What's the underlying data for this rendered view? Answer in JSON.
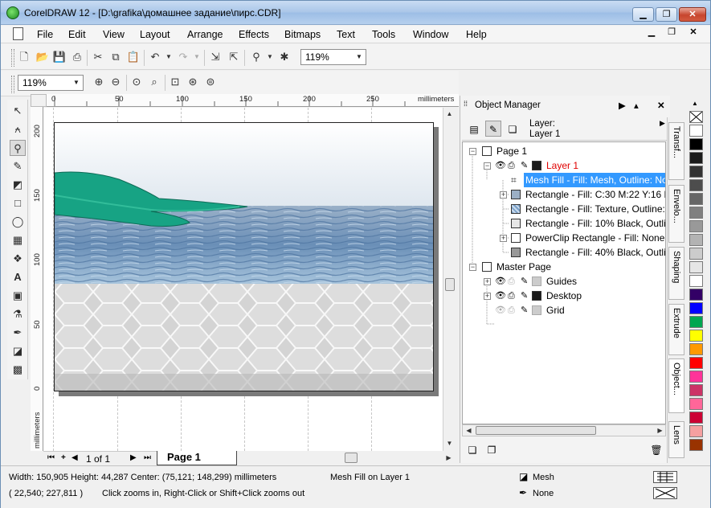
{
  "window": {
    "title": "CorelDRAW 12 - [D:\\grafika\\домашнее задание\\пирс.CDR]",
    "minimize": "▁",
    "maximize": "❐",
    "close": "✕"
  },
  "menu": [
    "File",
    "Edit",
    "View",
    "Layout",
    "Arrange",
    "Effects",
    "Bitmaps",
    "Text",
    "Tools",
    "Window",
    "Help"
  ],
  "toolbar": {
    "zoom_value": "119%"
  },
  "zoombar": {
    "zoom_value": "119%"
  },
  "rulers": {
    "units": "millimeters",
    "h_labels": [
      "0",
      "50",
      "100",
      "150",
      "200",
      "250"
    ],
    "v_labels": [
      "200",
      "150",
      "100",
      "50",
      "0"
    ]
  },
  "pages": {
    "counter": "1 of 1",
    "current_tab": "Page 1"
  },
  "object_manager": {
    "title": "Object Manager",
    "layer_label": "Layer:",
    "layer_name": "Layer 1",
    "tree": {
      "page1": "Page 1",
      "layer1": "Layer 1",
      "items": [
        "Mesh Fill - Fill: Mesh, Outline: No",
        "Rectangle - Fill: C:30 M:22 Y:16 K",
        "Rectangle - Fill: Texture, Outline:",
        "Rectangle - Fill: 10% Black, Outlin",
        "PowerClip Rectangle - Fill: None,",
        "Rectangle - Fill: 40% Black, Outlin"
      ],
      "master_page": "Master Page",
      "master_layers": [
        "Guides",
        "Desktop",
        "Grid"
      ]
    }
  },
  "side_tabs": [
    "Transf...",
    "Envelo...",
    "Shaping",
    "Extrude",
    "Object...",
    "Lens"
  ],
  "palette_colors": [
    "#ffffff",
    "#000000",
    "#1a1a1a",
    "#333333",
    "#4d4d4d",
    "#666666",
    "#808080",
    "#999999",
    "#b3b3b3",
    "#cccccc",
    "#e6e6e6",
    "#ffffff",
    "#330066",
    "#0000ff",
    "#00a651",
    "#ffff00",
    "#ff9900",
    "#ff0000",
    "#ff3399",
    "#cc3366",
    "#ff6699",
    "#cc0033",
    "#f5a0a0",
    "#993300"
  ],
  "status": {
    "dimensions": "Width: 150,905  Height: 44,287  Center: (75,121; 148,299)  millimeters",
    "selection": "Mesh Fill on Layer 1",
    "fill_label": "Mesh",
    "coords": "( 22,540; 227,811 )",
    "hint": "Click zooms in, Right-Click or Shift+Click zooms out",
    "outline_label": "None"
  }
}
